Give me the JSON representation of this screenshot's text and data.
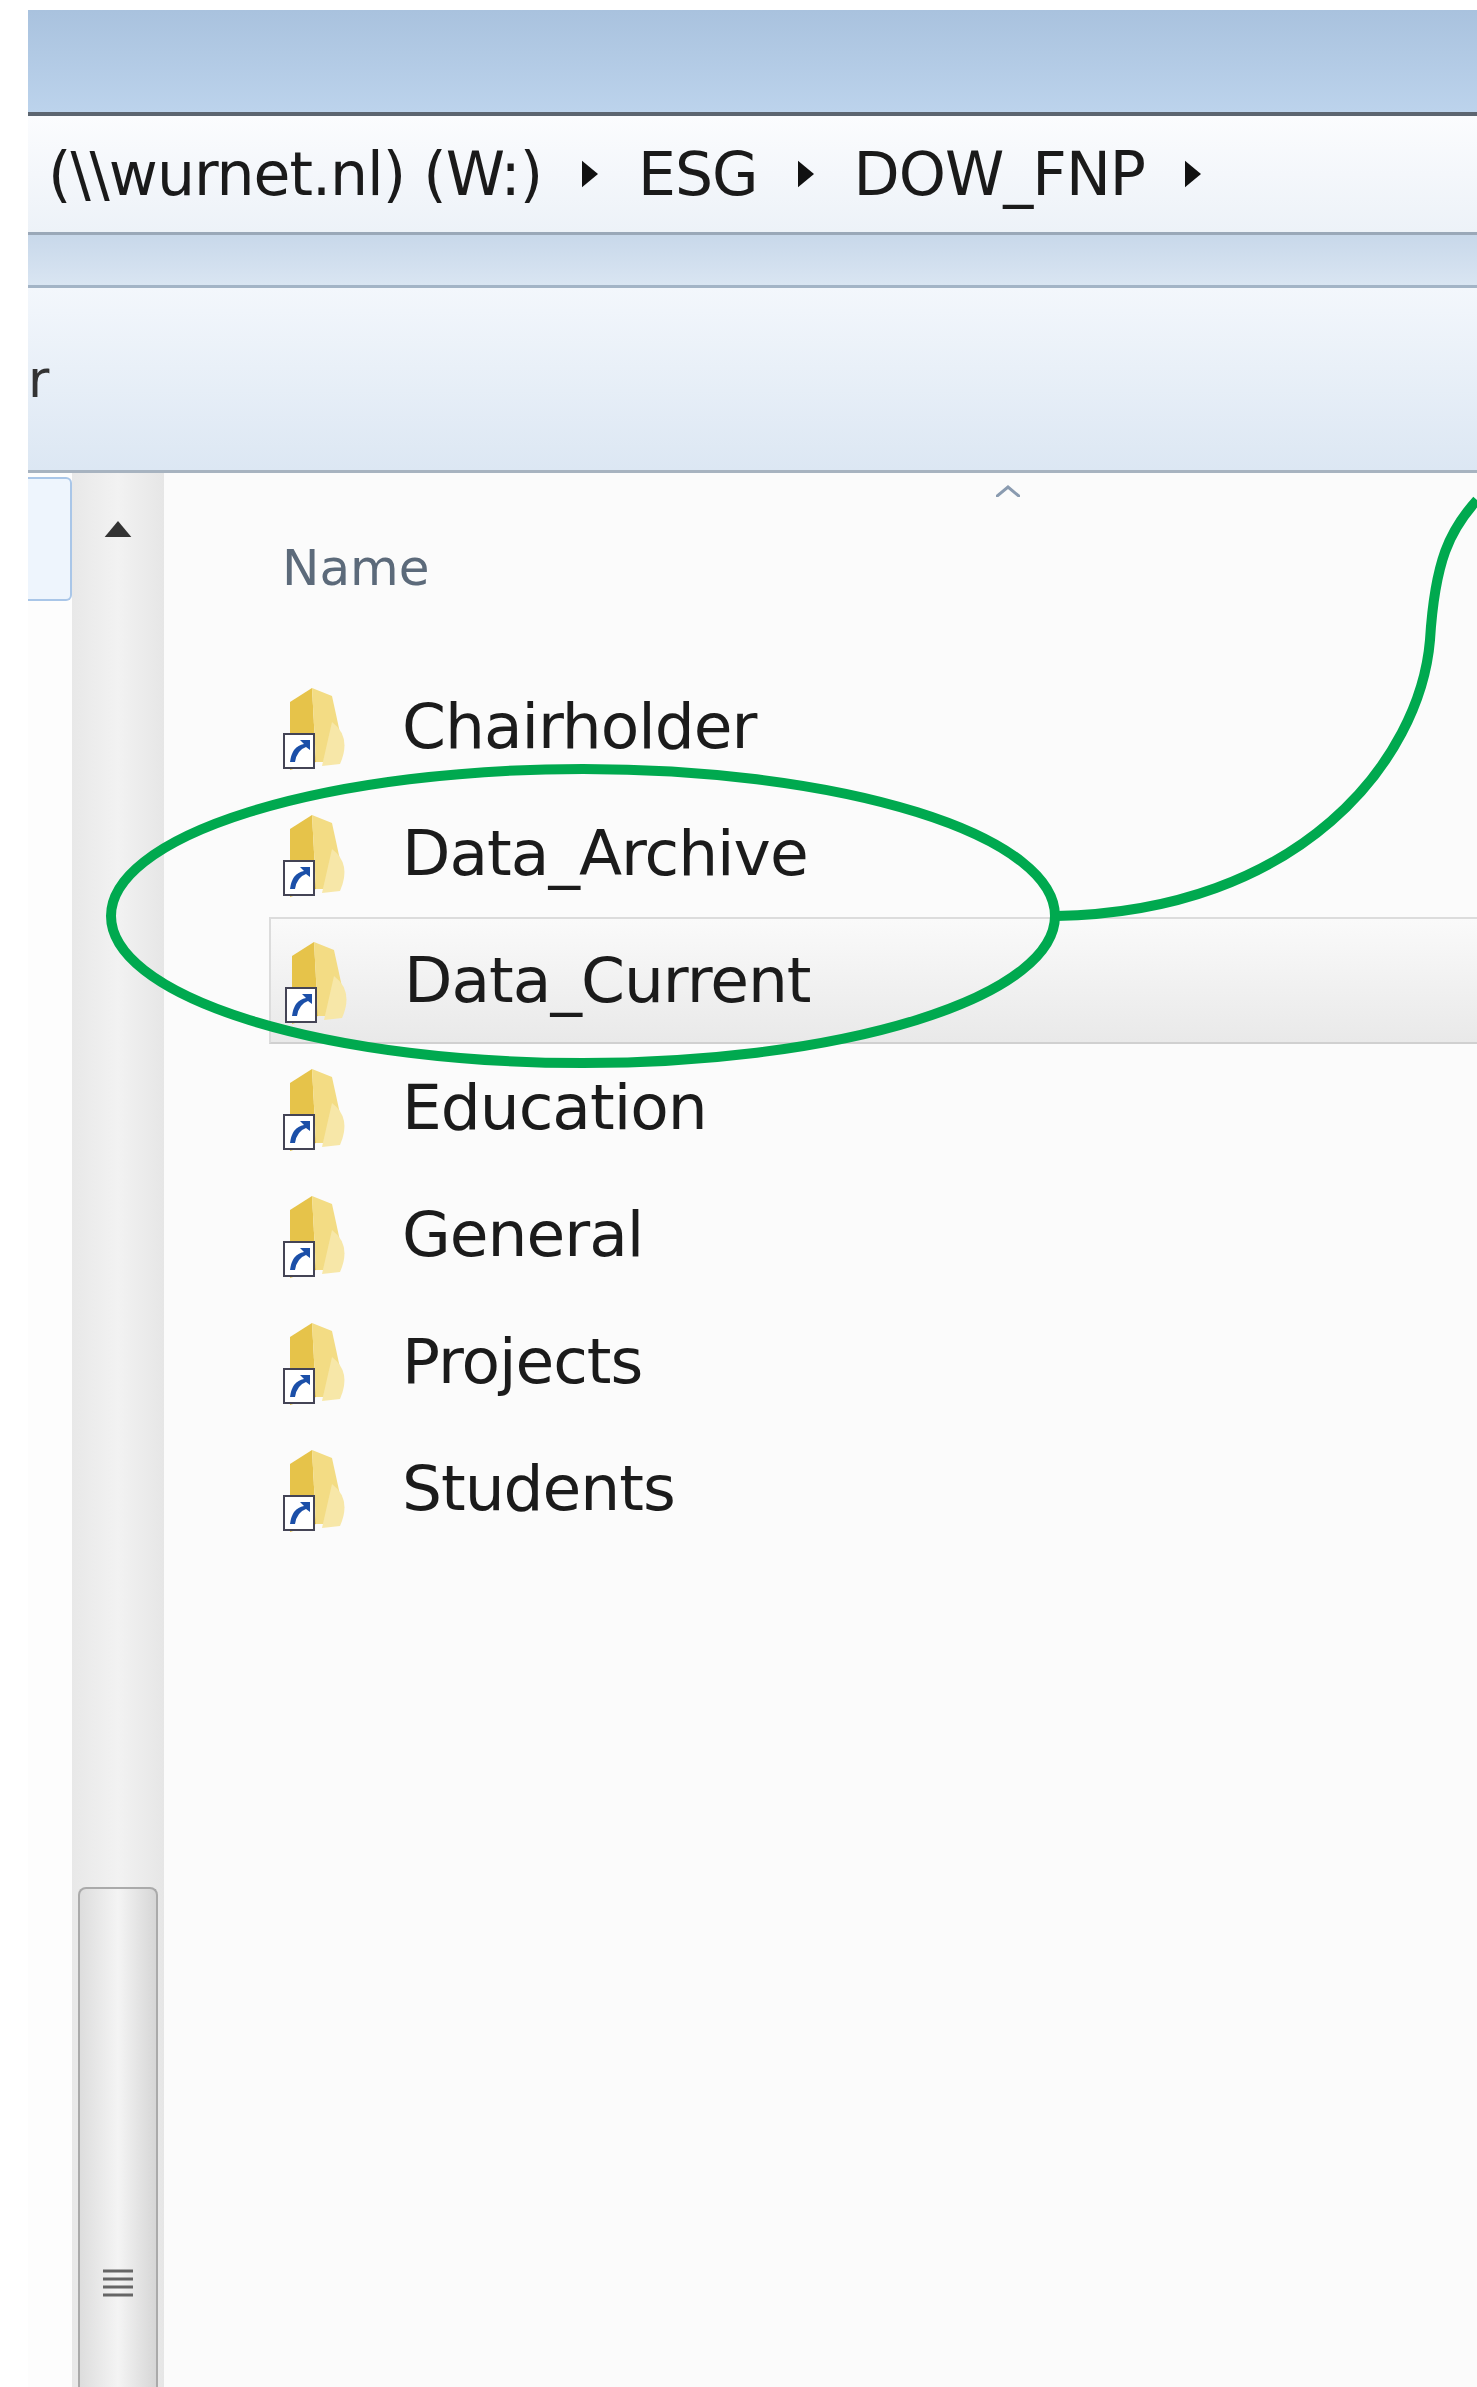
{
  "address_bar": {
    "segments": [
      {
        "label": "(\\\\wurnet.nl) (W:)"
      },
      {
        "label": "ESG"
      },
      {
        "label": "DOW_FNP"
      }
    ]
  },
  "toolbar": {
    "label": "r"
  },
  "file_list": {
    "column_header": "Name",
    "rows": [
      {
        "name": "Chairholder",
        "hovered": false
      },
      {
        "name": "Data_Archive",
        "hovered": false
      },
      {
        "name": "Data_Current",
        "hovered": true
      },
      {
        "name": "Education",
        "hovered": false
      },
      {
        "name": "General",
        "hovered": false
      },
      {
        "name": "Projects",
        "hovered": false
      },
      {
        "name": "Students",
        "hovered": false
      }
    ]
  }
}
